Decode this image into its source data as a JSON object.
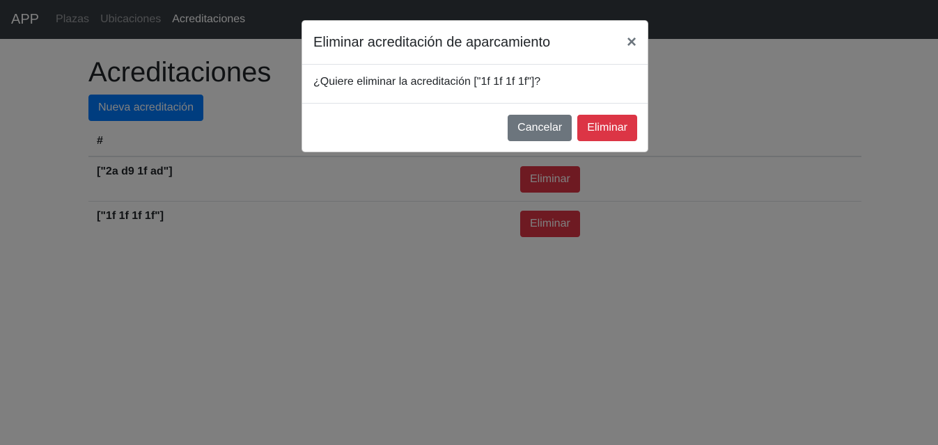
{
  "navbar": {
    "brand": "APP",
    "links": [
      {
        "label": "Plazas"
      },
      {
        "label": "Ubicaciones"
      },
      {
        "label": "Acreditaciones"
      }
    ]
  },
  "page": {
    "title": "Acreditaciones",
    "new_button": "Nueva acreditación",
    "table": {
      "header": "#",
      "rows": [
        {
          "code": "[\"2a d9 1f ad\"]",
          "action": "Eliminar"
        },
        {
          "code": "[\"1f 1f 1f 1f\"]",
          "action": "Eliminar"
        }
      ]
    }
  },
  "modal": {
    "title": "Eliminar acreditación de aparcamiento",
    "close": "×",
    "body": "¿Quiere eliminar la acreditación [\"1f 1f 1f 1f\"]?",
    "cancel": "Cancelar",
    "confirm": "Eliminar"
  },
  "colors": {
    "navbar": "#343a40",
    "primary": "#007bff",
    "danger": "#dc3545",
    "secondary": "#6c757d"
  }
}
